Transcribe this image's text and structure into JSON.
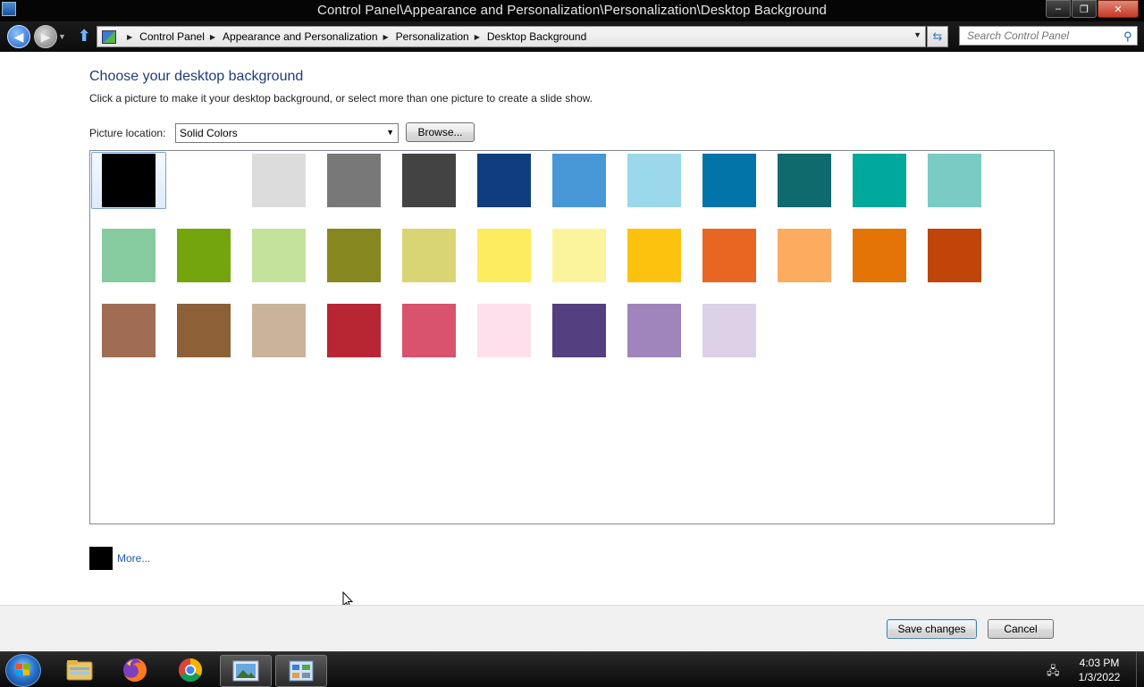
{
  "window": {
    "title": "Control Panel\\Appearance and Personalization\\Personalization\\Desktop Background",
    "minimize_glyph": "–",
    "maximize_glyph": "❐",
    "close_glyph": "✕"
  },
  "nav": {
    "breadcrumb": [
      "Control Panel",
      "Appearance and Personalization",
      "Personalization",
      "Desktop Background"
    ],
    "search_placeholder": "Search Control Panel"
  },
  "main": {
    "heading": "Choose your desktop background",
    "subtext": "Click a picture to make it your desktop background, or select more than one picture to create a slide show.",
    "picture_location_label": "Picture location:",
    "picture_location_value": "Solid Colors",
    "browse_label": "Browse...",
    "more_label": "More...",
    "more_color": "#000000",
    "selected_index": 0,
    "swatches": [
      "#000000",
      "#ffffff",
      "#dcdcdc",
      "#787878",
      "#434343",
      "#0f3d7d",
      "#4898d8",
      "#9cd8eb",
      "#0274a8",
      "#0f6a6e",
      "#00a99c",
      "#79cbc4",
      "#86cb9f",
      "#75a50c",
      "#c4e29c",
      "#878720",
      "#dad574",
      "#fdec60",
      "#fcf49c",
      "#fdc20d",
      "#e96622",
      "#fdab5f",
      "#e57406",
      "#c14408",
      "#a06c54",
      "#8d6037",
      "#c9b39a",
      "#b82533",
      "#d9526e",
      "#fde0ec",
      "#543f80",
      "#9f85bc",
      "#dcd1e7"
    ]
  },
  "footer": {
    "save_label": "Save changes",
    "cancel_label": "Cancel"
  },
  "taskbar": {
    "time": "4:03 PM",
    "date": "1/3/2022",
    "apps": [
      "file-explorer",
      "firefox",
      "chrome",
      "picture-viewer",
      "control-panel"
    ]
  }
}
